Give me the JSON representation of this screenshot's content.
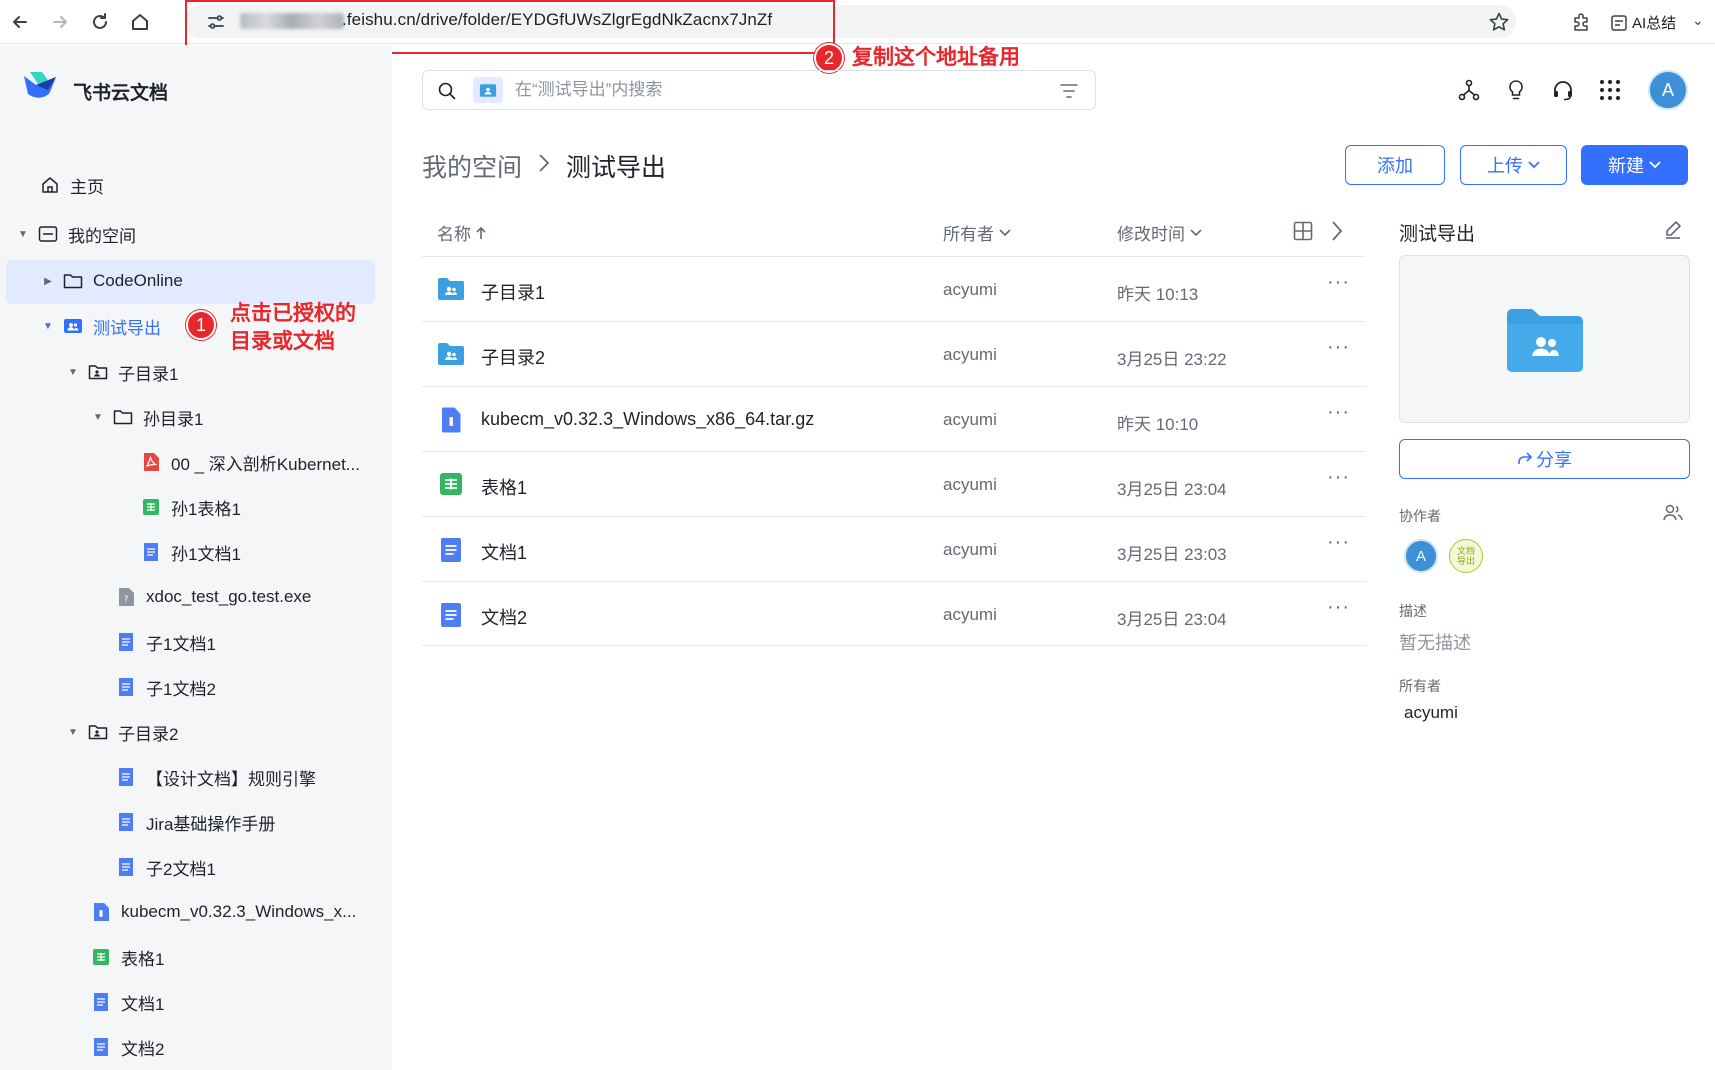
{
  "browser": {
    "url_visible": ".feishu.cn/drive/folder/EYDGfUWsZlgrEgdNkZacnx7JnZf",
    "ai_summary_label": "AI总结"
  },
  "annotations": {
    "badge_1": "1",
    "text_1_line1": "点击已授权的",
    "text_1_line2": "目录或文档",
    "badge_2": "2",
    "text_2": "复制这个地址备用"
  },
  "sidebar": {
    "app_name": "飞书云文档",
    "home": "主页",
    "my_space": "我的空间",
    "tree": [
      {
        "label": "CodeOnline"
      },
      {
        "label": "测试导出"
      },
      {
        "label": "子目录1"
      },
      {
        "label": "孙目录1"
      },
      {
        "label": "00 _ 深入剖析Kubernet..."
      },
      {
        "label": "孙1表格1"
      },
      {
        "label": "孙1文档1"
      },
      {
        "label": "xdoc_test_go.test.exe"
      },
      {
        "label": "子1文档1"
      },
      {
        "label": "子1文档2"
      },
      {
        "label": "子目录2"
      },
      {
        "label": "【设计文档】规则引擎"
      },
      {
        "label": "Jira基础操作手册"
      },
      {
        "label": "子2文档1"
      },
      {
        "label": "kubecm_v0.32.3_Windows_x..."
      },
      {
        "label": "表格1"
      },
      {
        "label": "文档1"
      },
      {
        "label": "文档2"
      }
    ]
  },
  "header": {
    "search_placeholder": "在“测试导出”内搜索",
    "avatar_letter": "A"
  },
  "breadcrumb": {
    "parent": "我的空间",
    "current": "测试导出"
  },
  "toolbar": {
    "add": "添加",
    "upload": "上传",
    "new": "新建"
  },
  "table": {
    "col_name": "名称",
    "col_owner": "所有者",
    "col_time": "修改时间",
    "rows": [
      {
        "name": "子目录1",
        "owner": "acyumi",
        "time": "昨天 10:13",
        "type": "shared-folder"
      },
      {
        "name": "子目录2",
        "owner": "acyumi",
        "time": "3月25日 23:22",
        "type": "shared-folder"
      },
      {
        "name": "kubecm_v0.32.3_Windows_x86_64.tar.gz",
        "owner": "acyumi",
        "time": "昨天 10:10",
        "type": "file"
      },
      {
        "name": "表格1",
        "owner": "acyumi",
        "time": "3月25日 23:04",
        "type": "sheet"
      },
      {
        "name": "文档1",
        "owner": "acyumi",
        "time": "3月25日 23:03",
        "type": "doc"
      },
      {
        "name": "文档2",
        "owner": "acyumi",
        "time": "3月25日 23:04",
        "type": "doc"
      }
    ]
  },
  "panel": {
    "title": "测试导出",
    "share": "分享",
    "collaborators_label": "协作者",
    "collab_avatar_1": "A",
    "collab_avatar_2_line1": "文档",
    "collab_avatar_2_line2": "导出",
    "description_label": "描述",
    "description_value": "暂无描述",
    "owner_label": "所有者",
    "owner_value": "acyumi"
  },
  "colors": {
    "accent": "#3370ff",
    "annotation_red": "#e8262b",
    "folder_blue": "#3b9fe0",
    "sheet_green": "#34b55f",
    "doc_blue": "#4e7df5",
    "pdf_red": "#e8473f"
  }
}
